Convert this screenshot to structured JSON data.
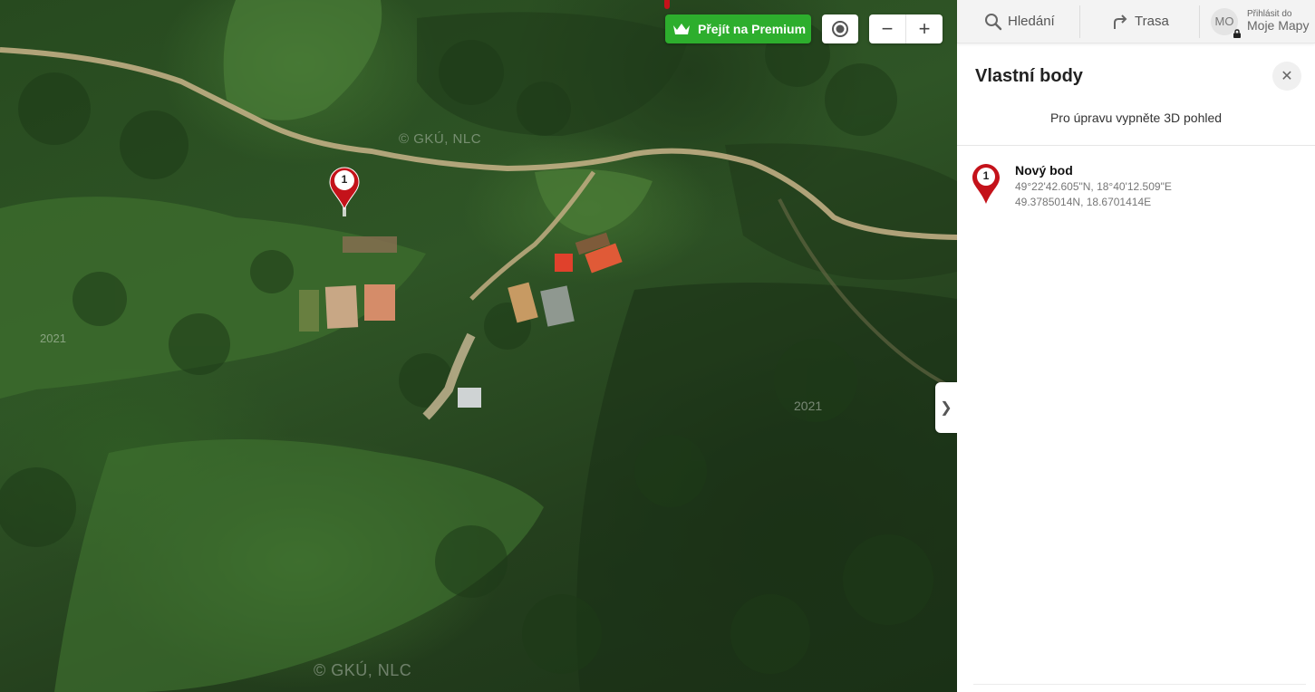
{
  "map": {
    "watermark": "© GKÚ, NLC",
    "year_label": "2021",
    "marker_number": "1",
    "premium_label": "Přejít na Premium",
    "zoom_out_label": "−",
    "zoom_in_label": "+",
    "collapse_label": "❯",
    "icons": [
      "crown-icon",
      "locate-icon",
      "location-pin-icon"
    ]
  },
  "topbar": {
    "search_label": "Hledání",
    "route_label": "Trasa",
    "avatar_initials": "MO",
    "login_small": "Přihlásit do",
    "login_big": "Moje Mapy"
  },
  "panel": {
    "title": "Vlastní body",
    "close_label": "✕",
    "hint": "Pro úpravu vypněte 3D pohled",
    "points": [
      {
        "number": "1",
        "name": "Nový bod",
        "coord_dms": "49°22'42.605\"N, 18°40'12.509\"E",
        "coord_dec": "49.3785014N, 18.6701414E"
      }
    ]
  },
  "colors": {
    "premium_green": "#2dae2d",
    "marker_red": "#c4121a"
  }
}
